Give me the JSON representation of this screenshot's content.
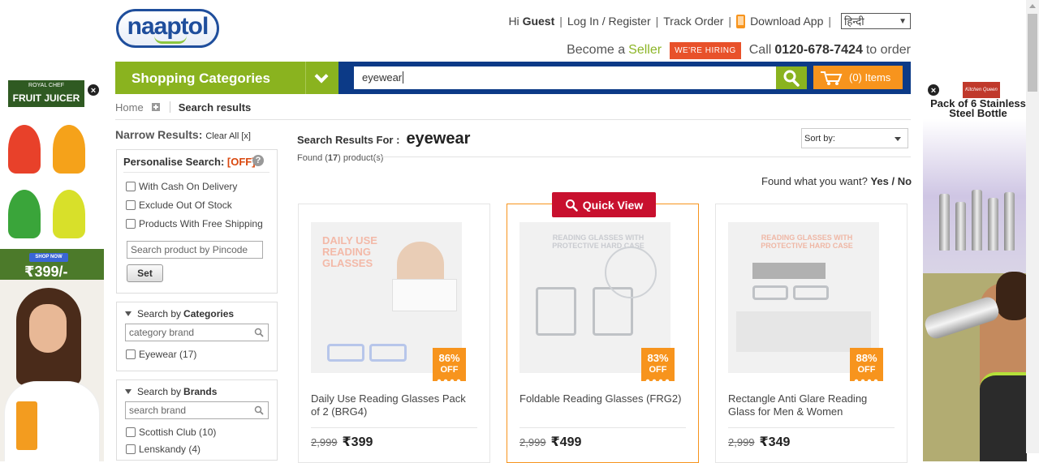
{
  "header": {
    "logo_text": "naaptol",
    "greeting": "Hi",
    "user": "Guest",
    "login": "Log In / Register",
    "track_order": "Track Order",
    "download_app": "Download App",
    "language": "हिन्दी",
    "become_a": "Become a",
    "seller": "Seller",
    "hiring": "WE'RE HIRING",
    "call": "Call",
    "phone": "0120-678-7424",
    "to_order": "to order"
  },
  "nav": {
    "categories_label": "Shopping Categories",
    "search_value": "eyewear",
    "cart_label": "(0) Items"
  },
  "breadcrumb": {
    "home": "Home",
    "current": "Search results"
  },
  "filters": {
    "narrow_title": "Narrow Results:",
    "clear_all": "Clear All [x]",
    "personalise_label": "Personalise Search:",
    "personalise_state": "[OFF]",
    "help": "?",
    "options": [
      "With Cash On Delivery",
      "Exclude Out Of Stock",
      "Products With Free Shipping"
    ],
    "pincode_placeholder": "Search product by Pincode",
    "set_button": "Set",
    "categories": {
      "title_prefix": "Search by",
      "title_bold": "Categories",
      "placeholder": "category brand",
      "items": [
        "Eyewear (17)"
      ]
    },
    "brands": {
      "title_prefix": "Search by",
      "title_bold": "Brands",
      "placeholder": "search brand",
      "items": [
        "Scottish Club (10)",
        "Lenskandy (4)"
      ]
    }
  },
  "results": {
    "label": "Search Results For :",
    "keyword": "eyewear",
    "found_prefix": "Found (",
    "found_count": "17",
    "found_suffix": ") product(s)",
    "sort_label": "Sort by:",
    "feedback_q": "Found what you want?",
    "yes": "Yes",
    "slash": "/",
    "no": "No",
    "quick_view": "Quick View"
  },
  "products": [
    {
      "name": "Daily Use Reading Glasses Pack of 2 (BRG4)",
      "mrp": "2,999",
      "price": "₹399",
      "discount": "86%",
      "off": "OFF",
      "img_text": "DAILY USE READING GLASSES"
    },
    {
      "name": "Foldable Reading Glasses (FRG2)",
      "mrp": "2,999",
      "price": "₹499",
      "discount": "83%",
      "off": "OFF",
      "img_text": "READING GLASSES WITH PROTECTIVE HARD CASE"
    },
    {
      "name": "Rectangle Anti Glare Reading Glass for Men & Women",
      "mrp": "2,999",
      "price": "₹349",
      "discount": "88%",
      "off": "OFF",
      "img_text": "READING GLASSES WITH PROTECTIVE HARD CASE"
    }
  ],
  "ads": {
    "left": {
      "brand": "ROYAL CHEF",
      "title": "FRUIT JUICER",
      "cta": "SHOP NOW",
      "price": "₹399/-",
      "close": "×"
    },
    "right": {
      "brand": "Kitchen Queen",
      "title": "Pack of 6 Stainless Steel Bottle",
      "close": "×"
    }
  },
  "colors": {
    "green": "#8ab31f",
    "navy": "#0c3a87",
    "orange": "#f7941d",
    "red": "#c8102e"
  }
}
